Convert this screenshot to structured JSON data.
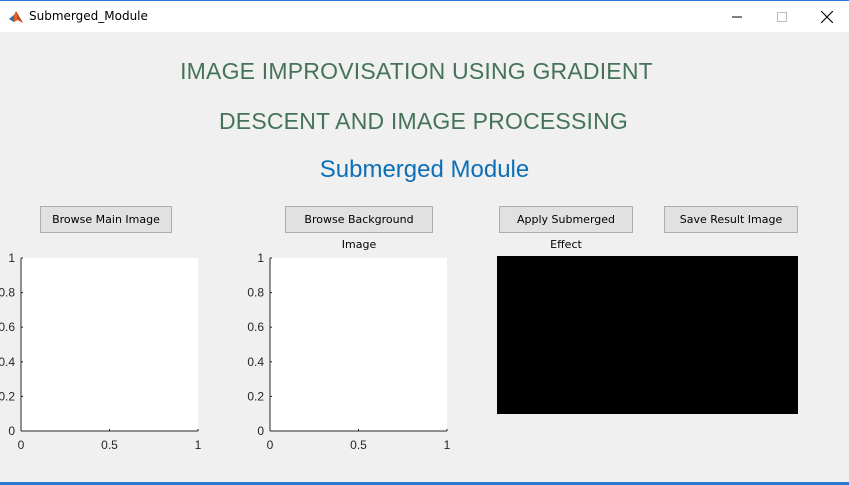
{
  "window": {
    "title": "Submerged_Module",
    "icon": "matlab-icon",
    "controls": [
      "minimize-icon",
      "maximize-icon",
      "close-icon"
    ]
  },
  "header": {
    "line1": "IMAGE IMPROVISATION USING  GRADIENT",
    "line2": "DESCENT AND  IMAGE PROCESSING",
    "subtitle": "Submerged Module",
    "heading_color": "#44735a",
    "subtitle_color": "#0d6fb8"
  },
  "buttons": {
    "browse_main": "Browse Main Image",
    "browse_background": "Browse Background Image",
    "apply_effect": "Apply Submerged Effect",
    "save_result": "Save Result Image"
  },
  "axes": {
    "x_ticks": [
      "0",
      "0.5",
      "1"
    ],
    "y_ticks": [
      "0",
      "0.2",
      "0.4",
      "0.6",
      "0.8",
      "1"
    ]
  },
  "result_image": {
    "fill": "#000000"
  }
}
